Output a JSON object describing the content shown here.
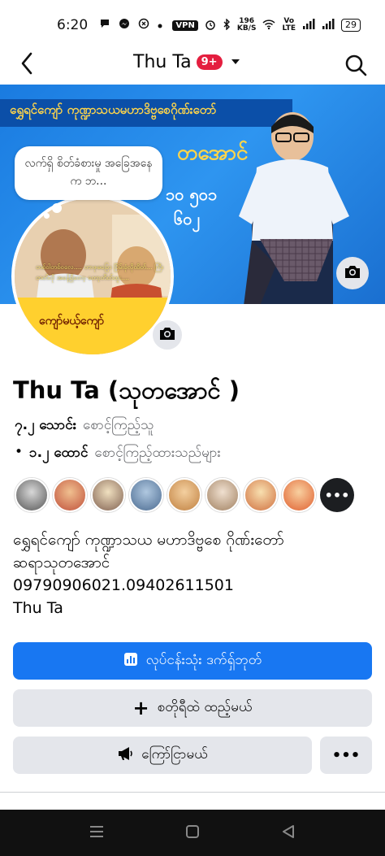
{
  "status_bar": {
    "time": "6:20",
    "vpn": "VPN",
    "net_speed_top": "196",
    "net_speed_bottom": "KB/S",
    "lte_top": "Vo",
    "lte_bottom": "LTE",
    "battery": "29"
  },
  "header": {
    "title": "Thu Ta",
    "badge": "9+"
  },
  "cover": {
    "banner_text": "ရွှေရင်ကျော် ကုဏ္ဍာသယမဟာဒိဗ္ဗစေဂိုဏ်းတော်",
    "big_text": "တအောင်",
    "number_line1": "၁၀ ၅၀၁",
    "number_line2": "၆၀၂"
  },
  "note": {
    "text": "လက်ရှိ စိတ်ခံစားမှု အခြေအနေက ဘ..."
  },
  "avatar": {
    "caption": "တစ်ဝါတစ်ဝလေ.... တာဇုဓခြော ငြိမ်းခုံလိုထိတ်... ကြီးတတ်လို အခန့်ရှိတော့ တော့တိတ်ထူး....",
    "bottom_text": "ကျော်မယ့်ကျော်"
  },
  "profile": {
    "name": "Thu Ta (သုတအောင် )",
    "followers_count": "၇.၂ သောင်း",
    "followers_label": "စောင့်ကြည့်သူ",
    "following_bullet": "•",
    "following_count": "၁.၂ ထောင်",
    "following_label": "စောင့်ကြည့်ထားသည်များ",
    "bio_lines": [
      "ရွှေရင်ကျော် ကုဏ္ဍာသယ မဟာဒိဗ္ဗစေ ဂိုဏ်းတော်",
      "ဆရာသုတအောင်",
      "09790906021.09402611501",
      "Thu Ta"
    ]
  },
  "friends": {
    "more": "•••",
    "colors": [
      "#8a8a8a",
      "#d07a4a",
      "#c0b090",
      "#6a8ab0",
      "#e0a060",
      "#c0a080",
      "#d0a070",
      "#e08050"
    ]
  },
  "buttons": {
    "dashboard": "လုပ်ငန်းသုံး ဒက်ရှ်ဘုတ်",
    "add_story_plus": "+",
    "add_story": "စတိုရီထဲ ထည့်မယ်",
    "promote": "ကြော်ငြာမယ်",
    "more": "•••"
  },
  "colors": {
    "primary": "#1877f2",
    "secondary_bg": "#e4e6eb",
    "badge": "#e41e3f"
  }
}
